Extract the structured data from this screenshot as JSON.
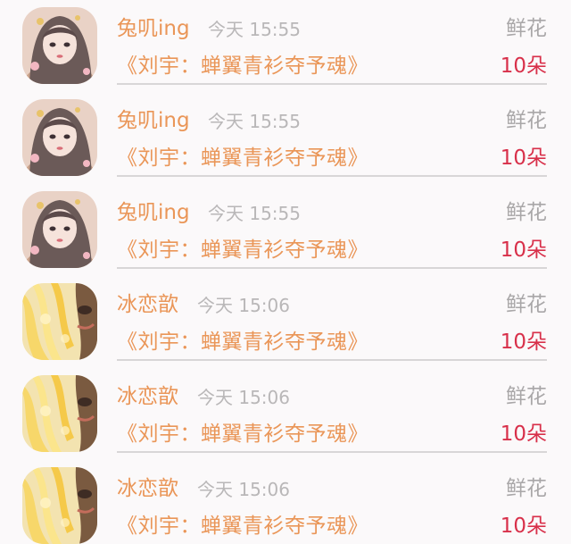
{
  "colors": {
    "name": "#ea9658",
    "work": "#ea9658",
    "count": "#d8304a",
    "time": "#b9b7b8",
    "kind": "#a9a7a8"
  },
  "gifts": [
    {
      "user": "兔叽ing",
      "time": "今天 15:55",
      "kind": "鲜花",
      "work": "《刘宇：蝉翼青衫夺予魂》",
      "count": "10朵",
      "avatar": "girl-portrait-avatar"
    },
    {
      "user": "兔叽ing",
      "time": "今天 15:55",
      "kind": "鲜花",
      "work": "《刘宇：蝉翼青衫夺予魂》",
      "count": "10朵",
      "avatar": "girl-portrait-avatar"
    },
    {
      "user": "兔叽ing",
      "time": "今天 15:55",
      "kind": "鲜花",
      "work": "《刘宇：蝉翼青衫夺予魂》",
      "count": "10朵",
      "avatar": "girl-portrait-avatar"
    },
    {
      "user": "冰恋歆",
      "time": "今天 15:06",
      "kind": "鲜花",
      "work": "《刘宇：蝉翼青衫夺予魂》",
      "count": "10朵",
      "avatar": "golden-light-avatar"
    },
    {
      "user": "冰恋歆",
      "time": "今天 15:06",
      "kind": "鲜花",
      "work": "《刘宇：蝉翼青衫夺予魂》",
      "count": "10朵",
      "avatar": "golden-light-avatar"
    },
    {
      "user": "冰恋歆",
      "time": "今天 15:06",
      "kind": "鲜花",
      "work": "《刘宇：蝉翼青衫夺予魂》",
      "count": "10朵",
      "avatar": "golden-light-avatar"
    }
  ]
}
